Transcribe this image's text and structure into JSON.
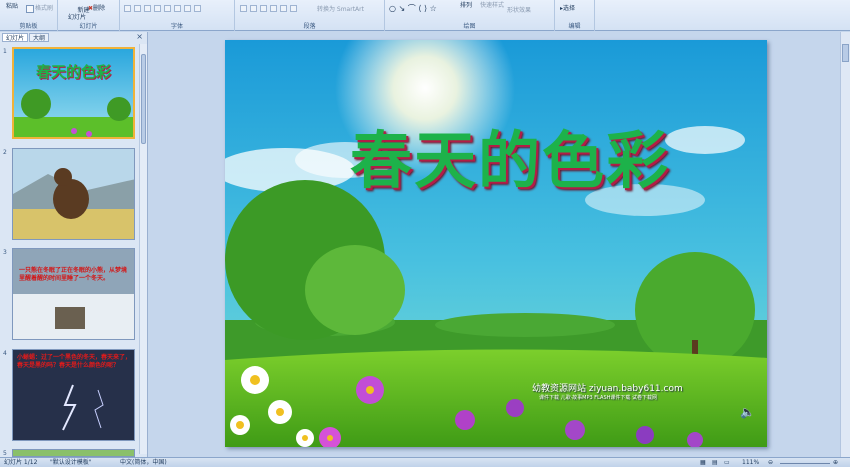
{
  "ribbon": {
    "clipboard": {
      "paste": "粘贴",
      "format_painter": "格式刷",
      "label": "剪贴板"
    },
    "slides": {
      "new_slide": "新建\n幻灯片",
      "delete": "删除",
      "label": "幻灯片"
    },
    "font": {
      "label": "字体"
    },
    "paragraph": {
      "convert_smartart": "转换为 SmartArt",
      "label": "段落"
    },
    "drawing": {
      "arrange": "排列",
      "quick_styles": "快速样式",
      "shape_effects": "形状效果",
      "label": "绘图"
    },
    "editing": {
      "select": "选择",
      "label": "编辑"
    }
  },
  "panel": {
    "tab_slides": "幻灯片",
    "tab_outline": "大纲",
    "close": "×",
    "thumbs": [
      {
        "num": "1",
        "title": "春天的色彩"
      },
      {
        "num": "2",
        "title": ""
      },
      {
        "num": "3",
        "title": "一只熊在冬眠了正在冬眠的小熊，从梦境里醒着醒的时间里睡了一个冬天。"
      },
      {
        "num": "4",
        "title": "小蜥蜴：过了一个黑色的冬天，春天来了，春天是黑的吗？春天是什么颜色的呢？"
      },
      {
        "num": "5",
        "title": ""
      }
    ]
  },
  "slide": {
    "title": "春天的色彩",
    "site": "幼教资源网站  ziyuan.baby611.com",
    "site_sub": "课件下载  儿歌·故事MP3  FLASH课件下载  试卷下载网"
  },
  "status": {
    "slide_info": "幻灯片 1/12",
    "theme": "\"默认设计模板\"",
    "language": "中文(简体，中国)",
    "zoom": "111%"
  },
  "colors": {
    "title_green": "#1db24a",
    "title_shadow": "#b21d46",
    "ribbon_bg": "#d4e2f4"
  }
}
